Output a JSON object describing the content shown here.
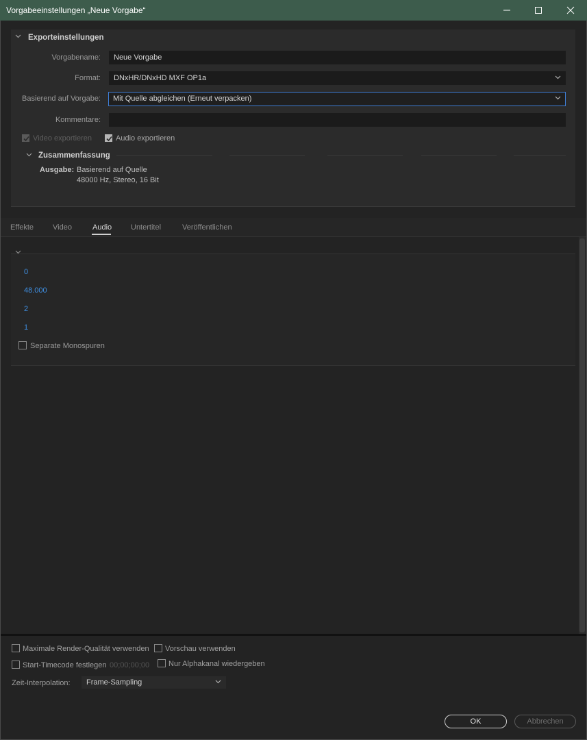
{
  "window": {
    "title": "Vorgabeeinstellungen „Neue Vorgabe“"
  },
  "export_settings": {
    "heading": "Exporteinstellungen",
    "preset_name_label": "Vorgabename:",
    "preset_name_value": "Neue Vorgabe",
    "format_label": "Format:",
    "format_value": "DNxHR/DNxHD MXF OP1a",
    "based_on_label": "Basierend auf Vorgabe:",
    "based_on_value": "Mit Quelle abgleichen (Erneut verpacken)",
    "comment_label": "Kommentare:",
    "comment_value": "",
    "video_export_label": "Video exportieren",
    "video_export_checked": true,
    "video_export_disabled": true,
    "audio_export_label": "Audio exportieren",
    "audio_export_checked": true
  },
  "summary": {
    "heading": "Zusammenfassung",
    "output_label": "Ausgabe:",
    "output_line1": "Basierend auf Quelle",
    "output_line2": "48000 Hz, Stereo, 16 Bit"
  },
  "tabs": [
    {
      "label": "Effekte",
      "active": false
    },
    {
      "label": "Video",
      "active": false
    },
    {
      "label": "Audio",
      "active": true
    },
    {
      "label": "Untertitel",
      "active": false
    },
    {
      "label": "Veröffentlichen",
      "active": false
    }
  ],
  "audio": {
    "values": [
      "0",
      "48.000",
      "2",
      "1"
    ],
    "mono_tracks_label": "Separate Monospuren",
    "mono_tracks_checked": false
  },
  "bottom": {
    "max_render_label": "Maximale Render-Qualität verwenden",
    "preview_label": "Vorschau verwenden",
    "start_timecode_label": "Start-Timecode festlegen",
    "start_timecode_value": "00;00;00;00",
    "alpha_only_label": "Nur Alphakanal wiedergeben",
    "time_interp_label": "Zeit-Interpolation:",
    "time_interp_value": "Frame-Sampling",
    "ok_label": "OK",
    "cancel_label": "Abbrechen"
  },
  "colors": {
    "titlebar": "#3d5c4c",
    "accent_blue": "#3f8ee0",
    "focus_border": "#3f7fd8"
  }
}
